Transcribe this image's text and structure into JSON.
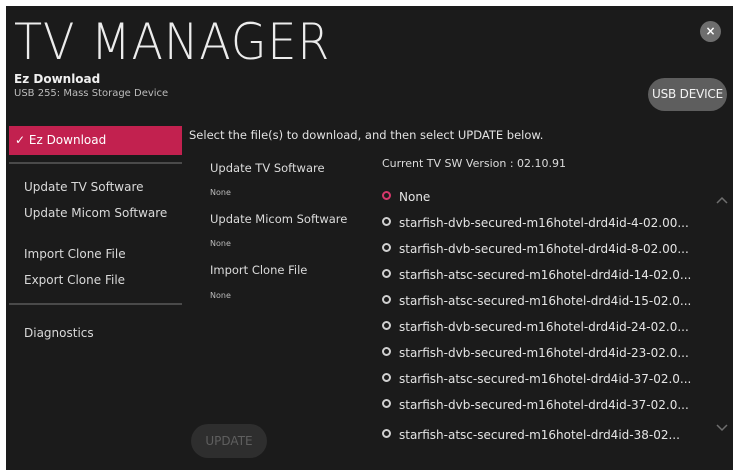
{
  "header": {
    "title": "TV MANAGER",
    "subtitle": "Ez Download",
    "device_info": "USB 255: Mass Storage Device",
    "close_label": "×",
    "usb_button": "USB DEVICE"
  },
  "sidebar": {
    "active_item": "✓ Ez Download",
    "items": [
      "Update TV Software",
      "Update Micom Software",
      "Import Clone File",
      "Export Clone File",
      "Diagnostics"
    ]
  },
  "main": {
    "instruction": "Select the file(s) to download, and then select UPDATE below.",
    "sections": [
      {
        "label": "Update TV Software",
        "value": "None"
      },
      {
        "label": "Update Micom Software",
        "value": "None"
      },
      {
        "label": "Import Clone File",
        "value": "None"
      }
    ],
    "current_version": "Current TV SW Version : 02.10.91",
    "files": [
      "None",
      "starfish-dvb-secured-m16hotel-drd4id-4-02.00...",
      "starfish-dvb-secured-m16hotel-drd4id-8-02.00...",
      "starfish-atsc-secured-m16hotel-drd4id-14-02.0...",
      "starfish-atsc-secured-m16hotel-drd4id-15-02.0...",
      "starfish-dvb-secured-m16hotel-drd4id-24-02.0...",
      "starfish-dvb-secured-m16hotel-drd4id-23-02.0...",
      "starfish-atsc-secured-m16hotel-drd4id-37-02.0...",
      "starfish-dvb-secured-m16hotel-drd4id-37-02.0...",
      "starfish-atsc-secured-m16hotel-drd4id-38-02..."
    ],
    "selected_file_index": 0,
    "update_button": "UPDATE"
  },
  "icons": {
    "scroll_up": "chevron-up-icon",
    "scroll_down": "chevron-down-icon",
    "close": "close-icon"
  },
  "colors": {
    "accent": "#c2214f",
    "background": "#1b1b1b"
  }
}
